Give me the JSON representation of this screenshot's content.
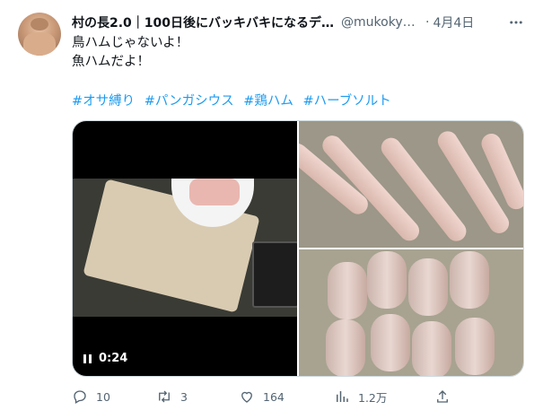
{
  "author": {
    "name": "村の長2.0｜100日後にバッキバキになるデ…",
    "handle": "@mukokyu…",
    "separator": "·",
    "date": "4月4日"
  },
  "tweet": {
    "lines": [
      "鳥ハムじゃないよ！",
      "魚ハムだよ！"
    ],
    "hashtags": [
      "#オサ縛り",
      "#パンガシウス",
      "#鶏ハム",
      "#ハーブソルト"
    ]
  },
  "video": {
    "duration": "0:24"
  },
  "actions": {
    "reply_count": "10",
    "retweet_count": "3",
    "like_count": "164",
    "view_count": "1.2万"
  },
  "colors": {
    "link": "#1d9bf0",
    "text": "#0f1419",
    "muted": "#536471",
    "border": "#cfd9de"
  },
  "icons": [
    "more-icon",
    "pause-icon",
    "reply-icon",
    "retweet-icon",
    "like-icon",
    "views-icon",
    "share-icon"
  ]
}
